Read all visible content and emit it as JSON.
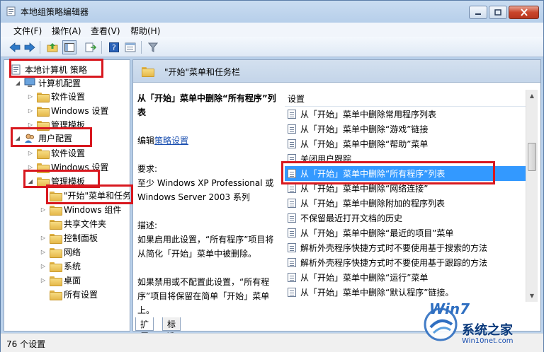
{
  "window": {
    "title": "本地组策略编辑器"
  },
  "menubar": [
    {
      "label": "文件(F)"
    },
    {
      "label": "操作(A)"
    },
    {
      "label": "查看(V)"
    },
    {
      "label": "帮助(H)"
    }
  ],
  "tree": {
    "items": [
      {
        "label": "本地计算机 策略"
      },
      {
        "label": "计算机配置"
      },
      {
        "label": "软件设置"
      },
      {
        "label": "Windows 设置"
      },
      {
        "label": "管理模板"
      },
      {
        "label": "用户配置"
      },
      {
        "label": "软件设置"
      },
      {
        "label": "Windows 设置"
      },
      {
        "label": "管理模板"
      },
      {
        "label": "\"开始\"菜单和任务栏"
      },
      {
        "label": "Windows 组件"
      },
      {
        "label": "共享文件夹"
      },
      {
        "label": "控制面板"
      },
      {
        "label": "网络"
      },
      {
        "label": "系统"
      },
      {
        "label": "桌面"
      },
      {
        "label": "所有设置"
      }
    ]
  },
  "right": {
    "header_title": "\"开始\"菜单和任务栏",
    "desc_title": "从「开始」菜单中删除“所有程序”列表",
    "edit_prefix": "编辑",
    "edit_link": "策略设置",
    "req_label": "要求:",
    "req_text": "至少 Windows XP Professional 或 Windows Server 2003 系列",
    "desc_label": "描述:",
    "desc_p1": "如果启用此设置，“所有程序”项目将从简化「开始」菜单中被删除。",
    "desc_p2": "如果禁用或不配置此设置，“所有程序”项目将保留在简单「开始」菜单上。",
    "list_header": "设置",
    "list": [
      {
        "label": "从「开始」菜单中删除常用程序列表"
      },
      {
        "label": "从「开始」菜单中删除“游戏”链接"
      },
      {
        "label": "从「开始」菜单中删除“帮助”菜单"
      },
      {
        "label": "关闭用户跟踪"
      },
      {
        "label": "从「开始」菜单中删除“所有程序”列表"
      },
      {
        "label": "从「开始」菜单中删除“网络连接”"
      },
      {
        "label": "从「开始」菜单中删除附加的程序列表"
      },
      {
        "label": "不保留最近打开文档的历史"
      },
      {
        "label": "从「开始」菜单中删除“最近的项目”菜单"
      },
      {
        "label": "解析外壳程序快捷方式时不要使用基于搜索的方法"
      },
      {
        "label": "解析外壳程序快捷方式时不要使用基于跟踪的方法"
      },
      {
        "label": "从「开始」菜单中删除“运行”菜单"
      },
      {
        "label": "从「开始」菜单中删除“默认程序”链接。"
      }
    ]
  },
  "tabs": [
    {
      "label": "扩展"
    },
    {
      "label": "标准"
    }
  ],
  "status": {
    "text": "76 个设置"
  },
  "watermark": {
    "brand": "Win7",
    "name": "系统之家",
    "url": "Win10net.com"
  }
}
